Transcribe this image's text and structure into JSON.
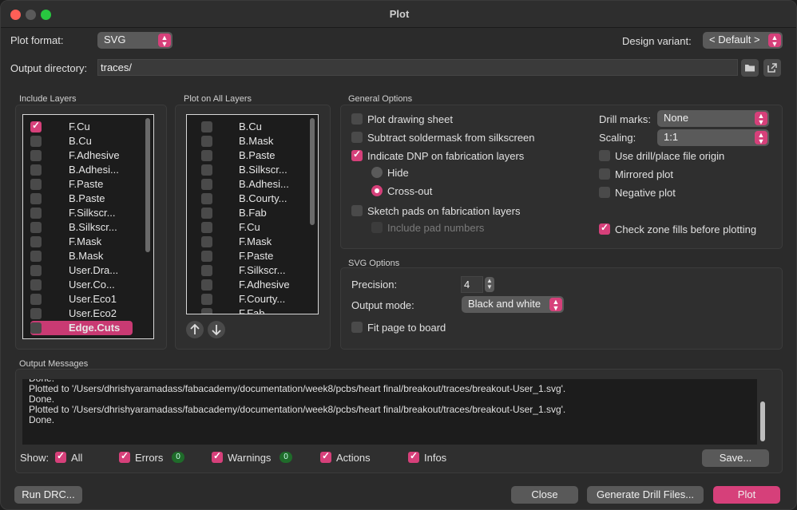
{
  "window": {
    "title": "Plot"
  },
  "top": {
    "plot_format_label": "Plot format:",
    "plot_format_value": "SVG",
    "design_variant_label": "Design variant:",
    "design_variant_value": "< Default >",
    "output_dir_label": "Output directory:",
    "output_dir_value": "traces/"
  },
  "include_layers": {
    "title": "Include Layers",
    "items": [
      {
        "label": "F.Cu",
        "checked": true
      },
      {
        "label": "B.Cu",
        "checked": false
      },
      {
        "label": "F.Adhesive",
        "checked": false
      },
      {
        "label": "B.Adhesi...",
        "checked": false
      },
      {
        "label": "F.Paste",
        "checked": false
      },
      {
        "label": "B.Paste",
        "checked": false
      },
      {
        "label": "F.Silkscr...",
        "checked": false
      },
      {
        "label": "B.Silkscr...",
        "checked": false
      },
      {
        "label": "F.Mask",
        "checked": false
      },
      {
        "label": "B.Mask",
        "checked": false
      },
      {
        "label": "User.Dra...",
        "checked": false
      },
      {
        "label": "User.Co...",
        "checked": false
      },
      {
        "label": "User.Eco1",
        "checked": false
      },
      {
        "label": "User.Eco2",
        "checked": false
      },
      {
        "label": "Edge.Cuts",
        "checked": false,
        "selected": true
      }
    ]
  },
  "plot_all_layers": {
    "title": "Plot on All Layers",
    "items": [
      "B.Cu",
      "B.Mask",
      "B.Paste",
      "B.Silkscr...",
      "B.Adhesi...",
      "B.Courty...",
      "B.Fab",
      "F.Cu",
      "F.Mask",
      "F.Paste",
      "F.Silkscr...",
      "F.Adhesive",
      "F.Courty...",
      "F.Fab"
    ],
    "up_icon": "arrow-up-icon",
    "down_icon": "arrow-down-icon"
  },
  "general": {
    "title": "General Options",
    "plot_drawing_sheet": "Plot drawing sheet",
    "subtract_soldermask": "Subtract soldermask from silkscreen",
    "indicate_dnp": "Indicate DNP on fabrication layers",
    "hide": "Hide",
    "cross_out": "Cross-out",
    "sketch_pads": "Sketch pads on fabrication layers",
    "include_pad_numbers": "Include pad numbers",
    "drill_marks_label": "Drill marks:",
    "drill_marks_value": "None",
    "scaling_label": "Scaling:",
    "scaling_value": "1:1",
    "use_drill_origin": "Use drill/place file origin",
    "mirrored_plot": "Mirrored plot",
    "negative_plot": "Negative plot",
    "check_zone_fills": "Check zone fills before plotting"
  },
  "svg": {
    "title": "SVG Options",
    "precision_label": "Precision:",
    "precision_value": "4",
    "output_mode_label": "Output mode:",
    "output_mode_value": "Black and white",
    "fit_page": "Fit page to board"
  },
  "messages": {
    "title": "Output Messages",
    "lines": [
      "Done.",
      "Plotted to '/Users/dhrishyaramadass/fabacademy/documentation/week8/pcbs/heart final/breakout/traces/breakout-User_1.svg'.",
      "Done.",
      "Plotted to '/Users/dhrishyaramadass/fabacademy/documentation/week8/pcbs/heart final/breakout/traces/breakout-User_1.svg'.",
      "Done."
    ],
    "show_label": "Show:",
    "all": "All",
    "errors": "Errors",
    "errors_count": "0",
    "warnings": "Warnings",
    "warnings_count": "0",
    "actions": "Actions",
    "infos": "Infos",
    "save": "Save..."
  },
  "footer": {
    "run_drc": "Run DRC...",
    "close": "Close",
    "generate_drill": "Generate Drill Files...",
    "plot": "Plot"
  },
  "colors": {
    "accent": "#d6407a",
    "background": "#2b2b2b"
  }
}
